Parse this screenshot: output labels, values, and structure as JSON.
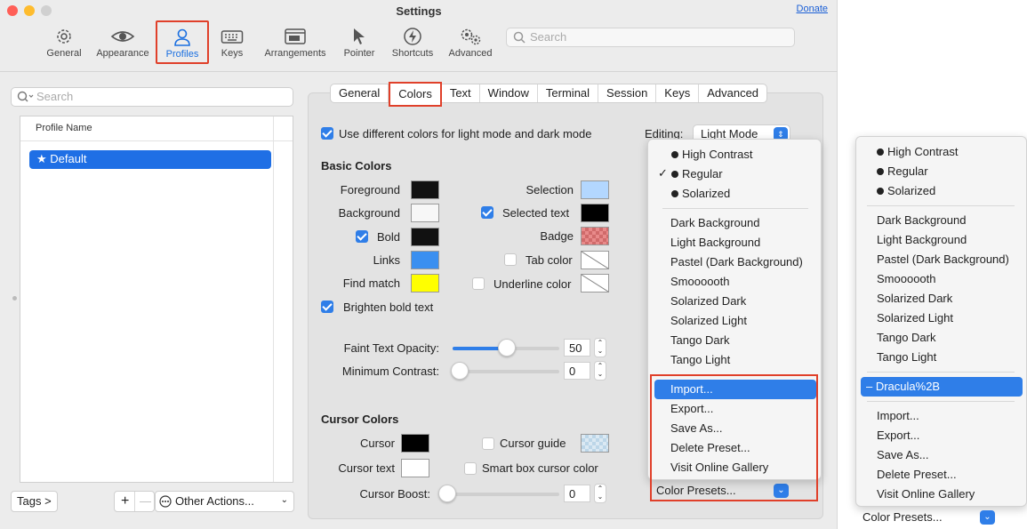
{
  "window": {
    "title": "Settings",
    "donate_label": "Donate"
  },
  "toolbar": {
    "items": [
      {
        "label": "General",
        "icon": "gear-icon"
      },
      {
        "label": "Appearance",
        "icon": "eye-icon"
      },
      {
        "label": "Profiles",
        "icon": "person-icon",
        "selected": true
      },
      {
        "label": "Keys",
        "icon": "keyboard-icon"
      },
      {
        "label": "Arrangements",
        "icon": "window-arrangement-icon"
      },
      {
        "label": "Pointer",
        "icon": "pointer-icon"
      },
      {
        "label": "Shortcuts",
        "icon": "lightning-icon"
      },
      {
        "label": "Advanced",
        "icon": "gears-icon"
      }
    ],
    "search_placeholder": "Search"
  },
  "sidebar": {
    "search_placeholder": "Search",
    "column_header": "Profile Name",
    "profiles": [
      {
        "name": "Default",
        "default": true
      }
    ],
    "tags_label": "Tags >",
    "add_label": "+",
    "remove_label": "—",
    "other_actions_label": "Other Actions..."
  },
  "tabs": [
    "General",
    "Colors",
    "Text",
    "Window",
    "Terminal",
    "Session",
    "Keys",
    "Advanced"
  ],
  "selected_tab": "Colors",
  "colors": {
    "use_different_label": "Use different colors for light mode and dark mode",
    "editing_label": "Editing:",
    "editing_value": "Light Mode",
    "basic_title": "Basic Colors",
    "foreground_label": "Foreground",
    "background_label": "Background",
    "bold_label": "Bold",
    "links_label": "Links",
    "find_match_label": "Find match",
    "selection_label": "Selection",
    "selected_text_label": "Selected text",
    "badge_label": "Badge",
    "tab_color_label": "Tab color",
    "underline_color_label": "Underline color",
    "brighten_bold_label": "Brighten bold text",
    "faint_opacity_label": "Faint Text Opacity:",
    "faint_opacity_value": "50",
    "min_contrast_label": "Minimum Contrast:",
    "min_contrast_value": "0",
    "cursor_title": "Cursor Colors",
    "cursor_label": "Cursor",
    "cursor_text_label": "Cursor text",
    "cursor_guide_label": "Cursor guide",
    "smart_box_label": "Smart box cursor color",
    "cursor_boost_label": "Cursor Boost:",
    "cursor_boost_value": "0",
    "presets_label": "Color Presets...",
    "swatches": {
      "foreground": "#111111",
      "background": "#f7f7f7",
      "bold": "#111111",
      "links": "#3a8ff0",
      "find_match": "#ffff00",
      "selection": "#b3d7ff",
      "selected_text": "#000000",
      "badge": "#e88a8a",
      "cursor": "#000000",
      "cursor_text": "#ffffff",
      "cursor_guide": "#cfe3f0"
    },
    "sliders": {
      "faint_opacity": 0.5,
      "min_contrast": 0,
      "cursor_boost": 0
    }
  },
  "presets_menu": {
    "builtin": [
      "High Contrast",
      "Regular",
      "Solarized"
    ],
    "checked": "Regular",
    "themes": [
      "Dark Background",
      "Light Background",
      "Pastel (Dark Background)",
      "Smoooooth",
      "Solarized Dark",
      "Solarized Light",
      "Tango Dark",
      "Tango Light"
    ],
    "actions": [
      "Import...",
      "Export...",
      "Save As...",
      "Delete Preset...",
      "Visit Online Gallery"
    ]
  },
  "presets_menu_2": {
    "builtin": [
      "High Contrast",
      "Regular",
      "Solarized"
    ],
    "themes": [
      "Dark Background",
      "Light Background",
      "Pastel (Dark Background)",
      "Smoooooth",
      "Solarized Dark",
      "Solarized Light",
      "Tango Dark",
      "Tango Light"
    ],
    "custom": [
      "Dracula%2B"
    ],
    "actions": [
      "Import...",
      "Export...",
      "Save As...",
      "Delete Preset...",
      "Visit Online Gallery"
    ],
    "presets_label": "Color Presets..."
  }
}
